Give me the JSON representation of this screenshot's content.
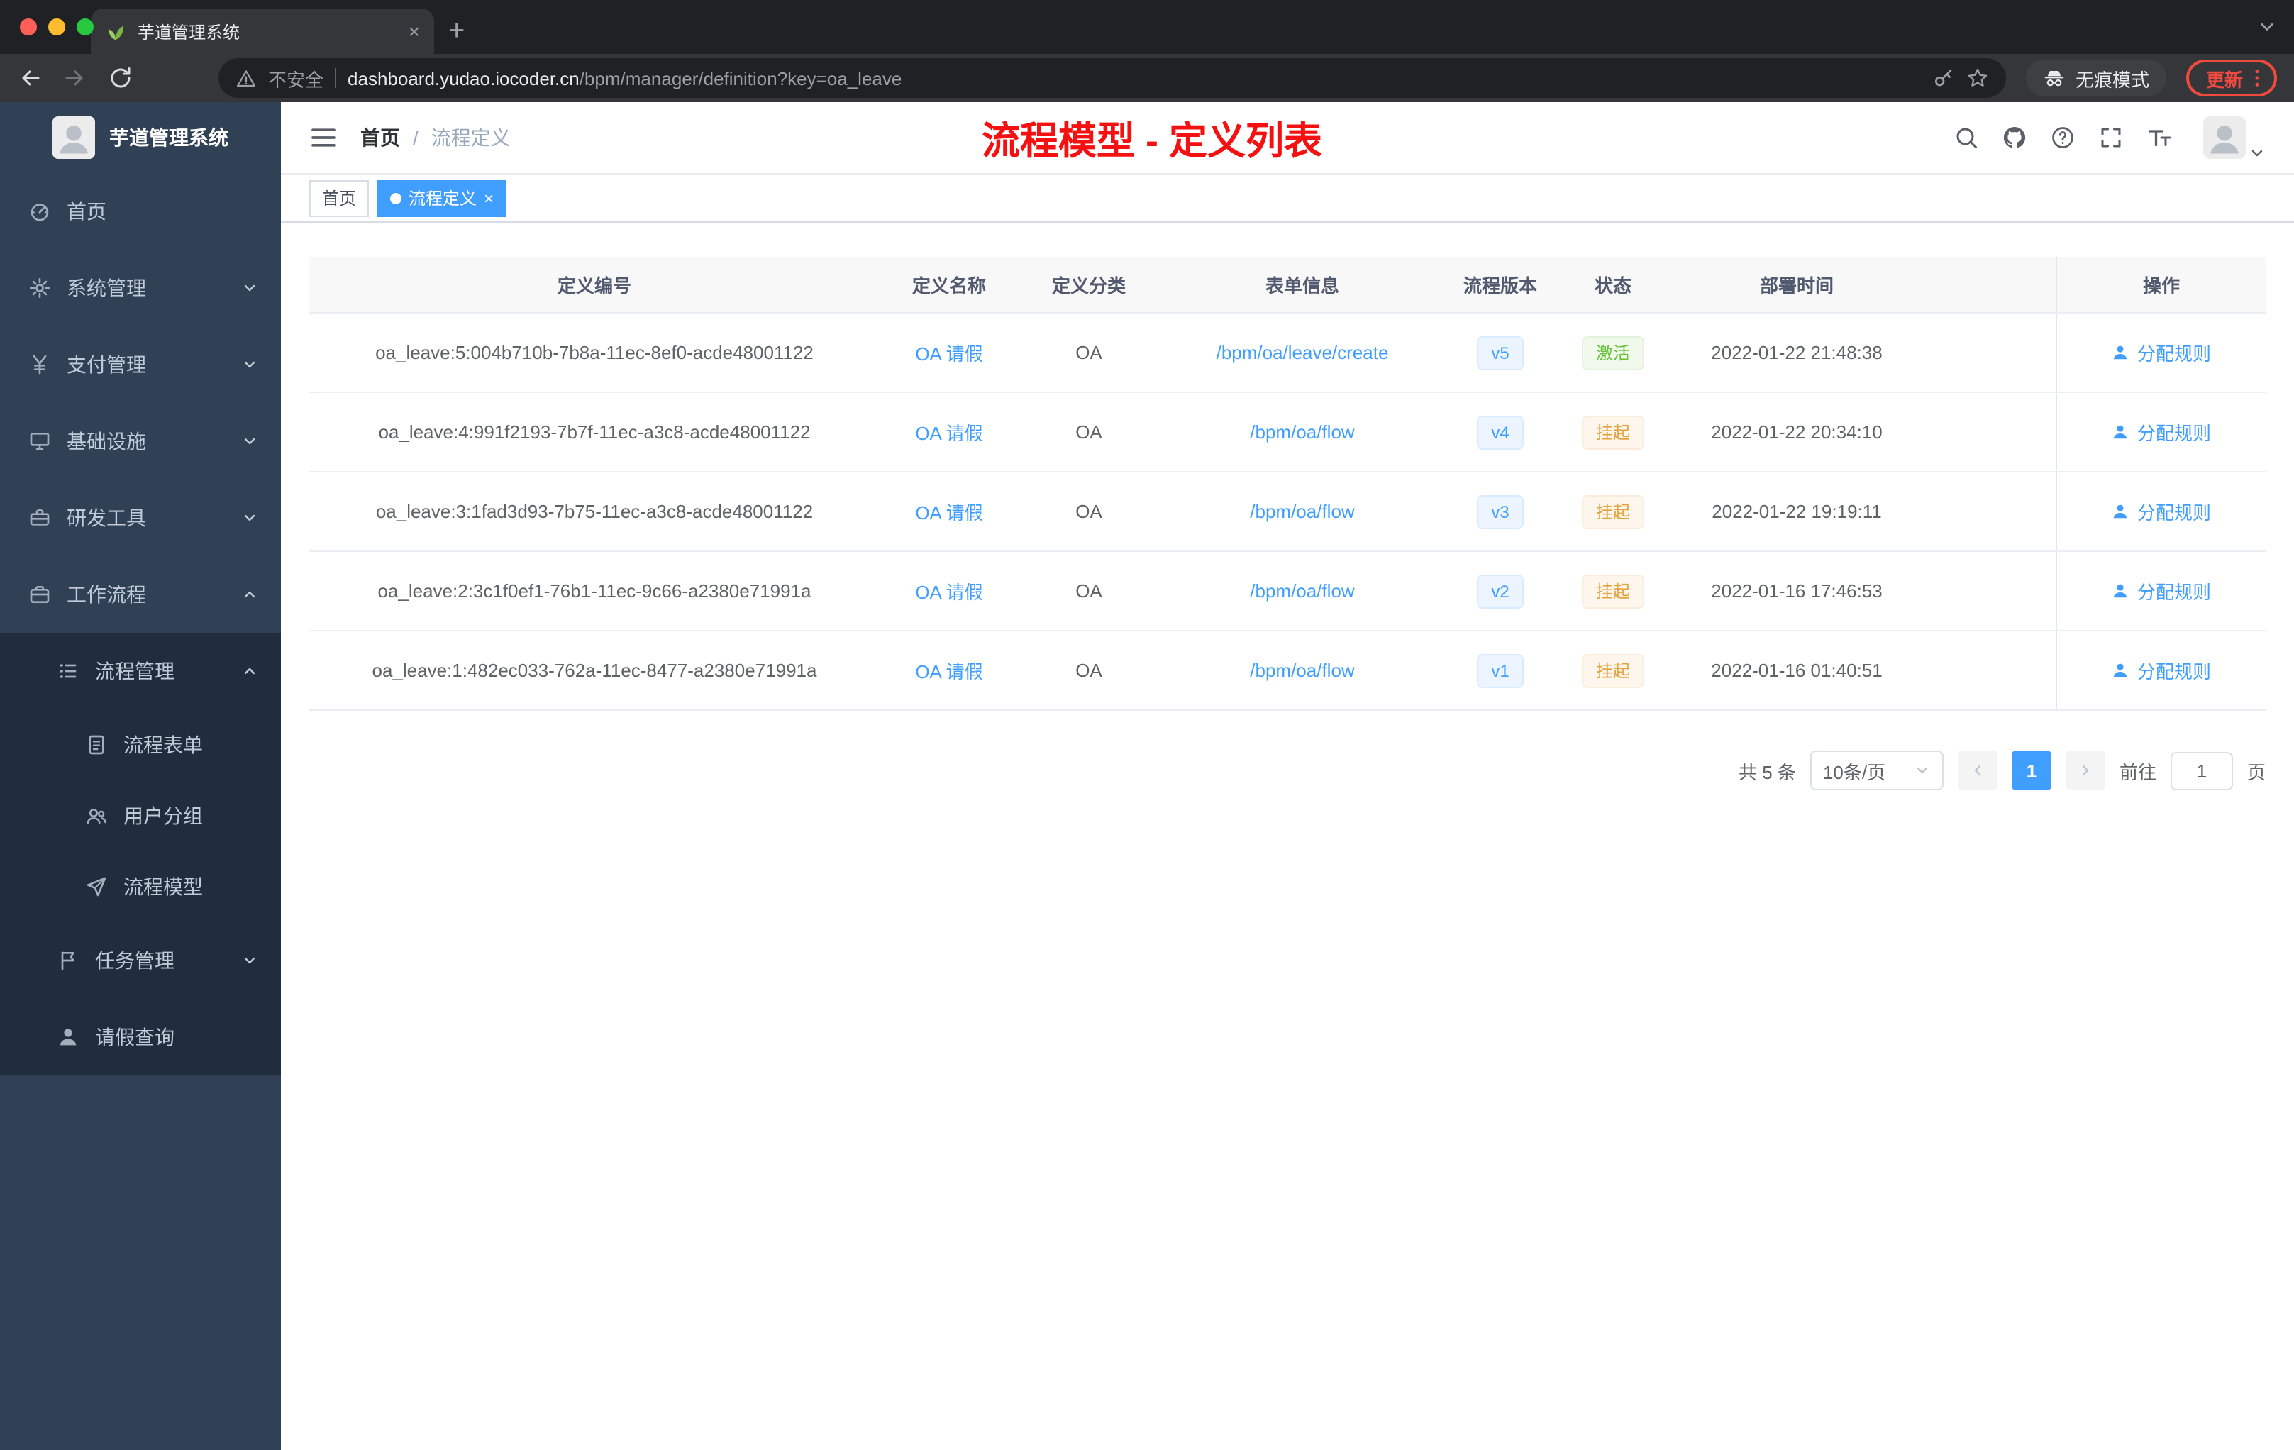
{
  "colors": {
    "primary": "#409eff",
    "success": "#67c23a",
    "warning": "#e6a23c",
    "danger": "#f04a3f",
    "annotation": "#f51111",
    "sidebar-bg": "#304156",
    "submenu-bg": "#1f2d3d"
  },
  "icons": {
    "favicon": "sprout-leaf",
    "navbar": [
      "search-icon",
      "github-icon",
      "question-icon",
      "fullscreen-icon",
      "font-size-icon"
    ],
    "action": "user-icon",
    "incognito": "incognito-hat-glasses-icon"
  },
  "browser": {
    "tab_title": "芋道管理系统",
    "close_glyph": "×",
    "new_tab_glyph": "+",
    "security_label": "不安全",
    "url_host": "dashboard.yudao.iocoder.cn",
    "url_path": "/bpm/manager/definition?key=oa_leave",
    "incognito_label": "无痕模式",
    "update_label": "更新"
  },
  "sidebar": {
    "logo_title": "芋道管理系统",
    "items": [
      {
        "label": "首页"
      },
      {
        "label": "系统管理"
      },
      {
        "label": "支付管理"
      },
      {
        "label": "基础设施"
      },
      {
        "label": "研发工具"
      },
      {
        "label": "工作流程"
      },
      {
        "label": "流程管理"
      },
      {
        "label": "流程表单"
      },
      {
        "label": "用户分组"
      },
      {
        "label": "流程模型"
      },
      {
        "label": "任务管理"
      },
      {
        "label": "请假查询"
      }
    ]
  },
  "header": {
    "breadcrumb_home": "首页",
    "breadcrumb_sep": "/",
    "breadcrumb_current": "流程定义",
    "annotation": "流程模型 - 定义列表"
  },
  "tags": {
    "home": "首页",
    "active": "流程定义",
    "close_glyph": "×"
  },
  "table": {
    "columns": [
      "定义编号",
      "定义名称",
      "定义分类",
      "表单信息",
      "流程版本",
      "状态",
      "部署时间",
      "操作"
    ],
    "rows": [
      {
        "id": "oa_leave:5:004b710b-7b8a-11ec-8ef0-acde48001122",
        "name": "OA 请假",
        "category": "OA",
        "form": "/bpm/oa/leave/create",
        "version": "v5",
        "version_type": "info",
        "status": "激活",
        "status_type": "success",
        "deploy_time": "2022-01-22 21:48:38",
        "action": "分配规则"
      },
      {
        "id": "oa_leave:4:991f2193-7b7f-11ec-a3c8-acde48001122",
        "name": "OA 请假",
        "category": "OA",
        "form": "/bpm/oa/flow",
        "version": "v4",
        "version_type": "info",
        "status": "挂起",
        "status_type": "warning",
        "deploy_time": "2022-01-22 20:34:10",
        "action": "分配规则"
      },
      {
        "id": "oa_leave:3:1fad3d93-7b75-11ec-a3c8-acde48001122",
        "name": "OA 请假",
        "category": "OA",
        "form": "/bpm/oa/flow",
        "version": "v3",
        "version_type": "info",
        "status": "挂起",
        "status_type": "warning",
        "deploy_time": "2022-01-22 19:19:11",
        "action": "分配规则"
      },
      {
        "id": "oa_leave:2:3c1f0ef1-76b1-11ec-9c66-a2380e71991a",
        "name": "OA 请假",
        "category": "OA",
        "form": "/bpm/oa/flow",
        "version": "v2",
        "version_type": "info",
        "status": "挂起",
        "status_type": "warning",
        "deploy_time": "2022-01-16 17:46:53",
        "action": "分配规则"
      },
      {
        "id": "oa_leave:1:482ec033-762a-11ec-8477-a2380e71991a",
        "name": "OA 请假",
        "category": "OA",
        "form": "/bpm/oa/flow",
        "version": "v1",
        "version_type": "info",
        "status": "挂起",
        "status_type": "warning",
        "deploy_time": "2022-01-16 01:40:51",
        "action": "分配规则"
      }
    ]
  },
  "pagination": {
    "total": "共 5 条",
    "page_size": "10条/页",
    "current_page": "1",
    "goto_label": "前往",
    "goto_value": "1",
    "page_unit": "页"
  }
}
